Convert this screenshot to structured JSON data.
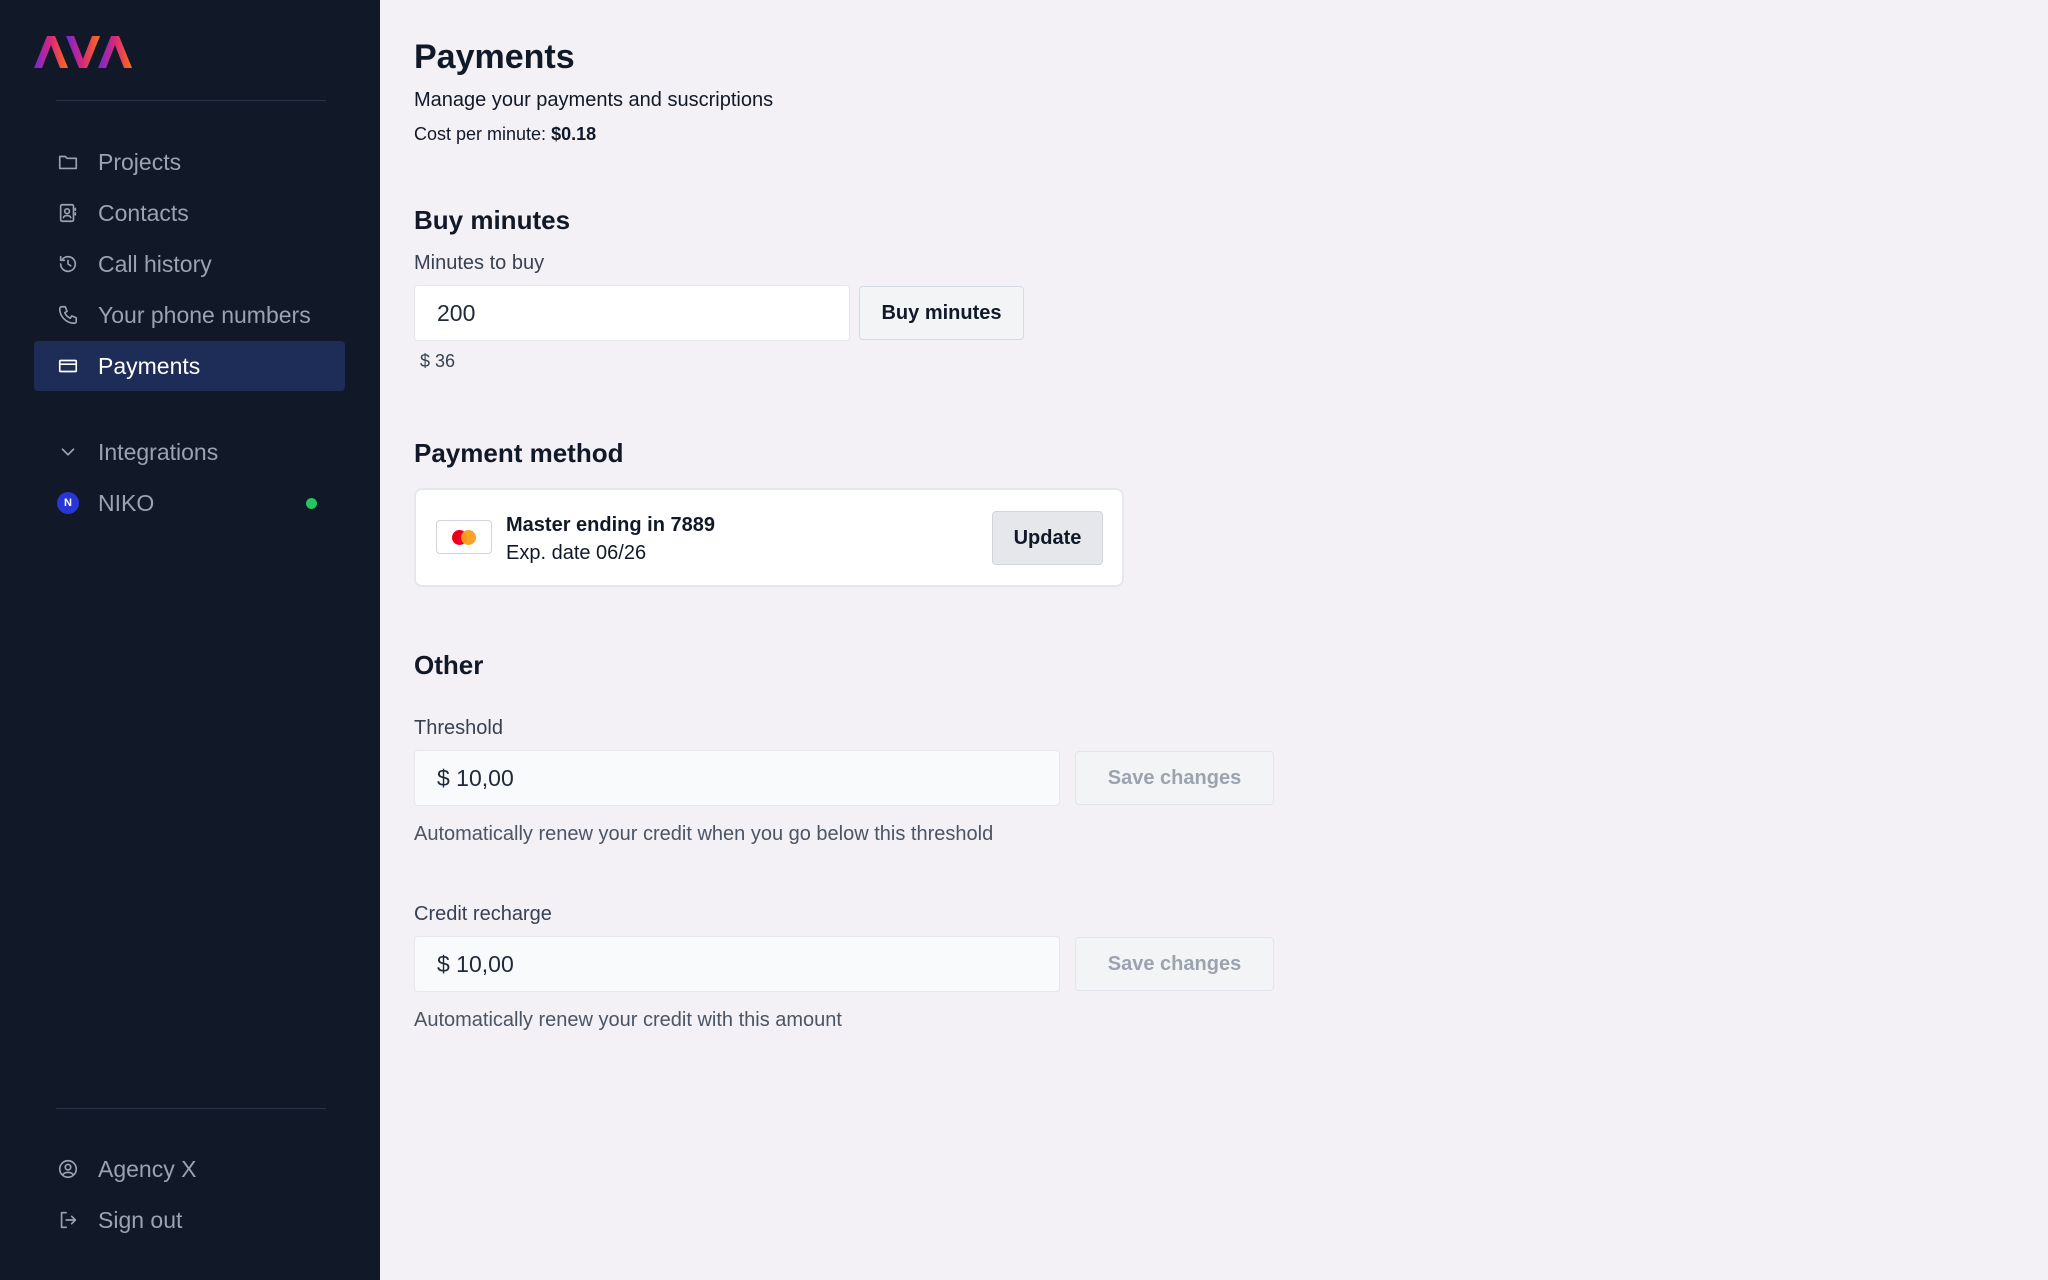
{
  "sidebar": {
    "logo_text": "AVA",
    "nav": [
      {
        "label": "Projects",
        "icon": "folder-icon"
      },
      {
        "label": "Contacts",
        "icon": "contacts-icon"
      },
      {
        "label": "Call history",
        "icon": "history-icon"
      },
      {
        "label": "Your phone numbers",
        "icon": "phone-icon"
      },
      {
        "label": "Payments",
        "icon": "card-icon",
        "active": true
      }
    ],
    "integrations": {
      "label": "Integrations",
      "icon": "chevron-down-icon",
      "items": [
        {
          "label": "NIKO",
          "avatar": "N",
          "status": "online"
        }
      ]
    },
    "footer": [
      {
        "label": "Agency X",
        "icon": "user-circle-icon"
      },
      {
        "label": "Sign out",
        "icon": "sign-out-icon"
      }
    ]
  },
  "page": {
    "title": "Payments",
    "subtitle": "Manage your payments and suscriptions",
    "cost_label": "Cost per minute: ",
    "cost_value": "$0.18"
  },
  "buy_minutes": {
    "title": "Buy minutes",
    "field_label": "Minutes to buy",
    "value": "200",
    "button": "Buy minutes",
    "total": "$ 36"
  },
  "payment_method": {
    "title": "Payment method",
    "card_name": "Master ending in 7889",
    "exp_date": "Exp. date 06/26",
    "button": "Update"
  },
  "other": {
    "title": "Other",
    "threshold": {
      "label": "Threshold",
      "value": "$ 10,00",
      "button": "Save changes",
      "helper": "Automatically renew your credit when you go below this threshold"
    },
    "recharge": {
      "label": "Credit recharge",
      "value": "$ 10,00",
      "button": "Save changes",
      "helper": "Automatically renew your credit with this amount"
    }
  },
  "colors": {
    "sidebar_bg": "#111827",
    "active_bg": "#1e2d57",
    "page_bg": "#f3f0f6",
    "status_online": "#22c55e",
    "logo_gradient": [
      "#6d28d9",
      "#db2777",
      "#f97316"
    ]
  }
}
